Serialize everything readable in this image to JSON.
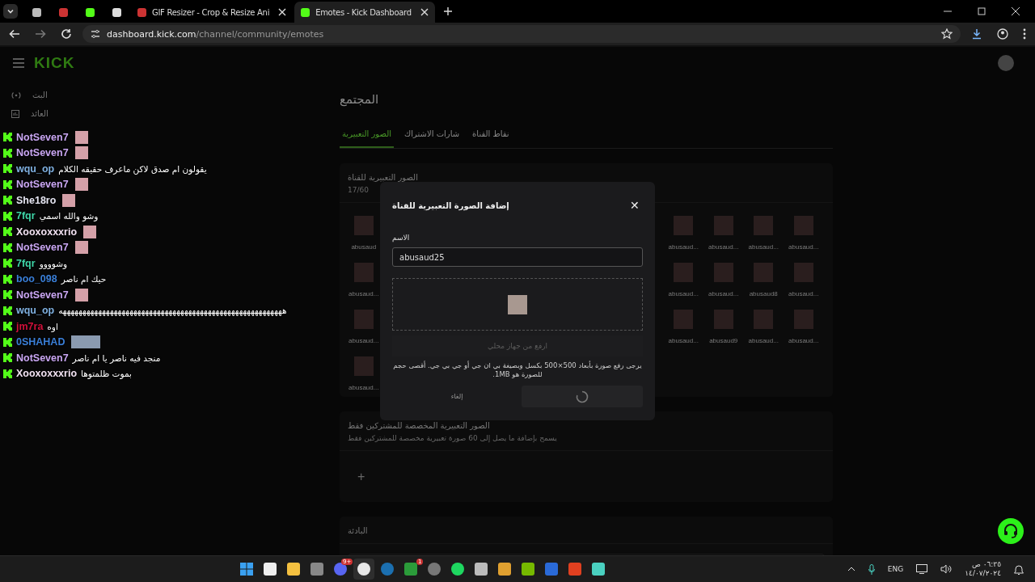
{
  "browser": {
    "tabs": [
      {
        "kind": "kick",
        "title": "Emotes - Kick Dashboard",
        "selected": true
      },
      {
        "kind": "gif",
        "title": "GIF Resizer - Crop & Resize Ani",
        "selected": false
      },
      {
        "kind": "shield",
        "selected": false
      },
      {
        "kind": "kick",
        "selected": false
      },
      {
        "kind": "gif",
        "selected": false
      },
      {
        "kind": "globe",
        "selected": false
      }
    ],
    "url_host": "dashboard.kick.com",
    "url_path": "/channel/community/emotes"
  },
  "header": {
    "logo": "KICK"
  },
  "sidebar": {
    "items": [
      {
        "kind": "live",
        "label": "البث"
      },
      {
        "kind": "revenue",
        "label": "العائد"
      }
    ]
  },
  "page": {
    "title": "المجتمع",
    "tabs": [
      {
        "label": "نقاط القناة",
        "selected": false
      },
      {
        "label": "شارات الاشتراك",
        "selected": false
      },
      {
        "label": "الصور التعبيرية",
        "selected": true
      }
    ]
  },
  "emotes_card": {
    "title": "الصور التعبيرية للقناة",
    "count": "17/60",
    "rows": [
      {
        "right": [
          "abusaud...",
          "abusaud...",
          "abusaud...",
          "abusaud..."
        ],
        "left": [
          "abusaud"
        ]
      },
      {
        "right": [
          "abusaud...",
          "abusaud8",
          "abusaud...",
          "abusaud..."
        ],
        "left": [
          "abusaud..."
        ]
      },
      {
        "right": [
          "abusaud...",
          "abusaud...",
          "abusaud9",
          "abusaud..."
        ],
        "left": [
          "abusaud..."
        ]
      },
      {
        "right": [],
        "left": [
          "abusaud..."
        ]
      }
    ]
  },
  "subscriber_card": {
    "title": "الصور التعبيرية المخصصة للمشتركين فقط",
    "subtitle": "يسمح بإضافة ما يصل إلى 60 صورة تعبيرية مخصصة للمشتركين فقط",
    "add": "+"
  },
  "banner_card": {
    "title": "البادئة"
  },
  "modal": {
    "title": "إضافة الصورة التعبيرية للقناة",
    "close": "✕",
    "name_label": "الاسم",
    "name_value": "abusaud25",
    "upload": {
      "label": "ارفع من جهاز محلي",
      "disabled": true
    },
    "hint": "يرجى رفع صورة بأبعاد 500×500 بكسل وبصيغة بي ان جي أو جي بي جي. أقصى حجم للصورة هو 1MB.",
    "cancel": "إلغاء",
    "submit_loading": true
  },
  "chat": [
    {
      "user": "NotSeven7",
      "color": "#c9a6f2",
      "kind": "emote"
    },
    {
      "user": "NotSeven7",
      "color": "#c9a6f2",
      "kind": "emote"
    },
    {
      "user": "wqu_op",
      "color": "#7fb0e0",
      "kind": "text",
      "text": "يقولون ام صدق لاكن ماعرف حقيقه الكلام"
    },
    {
      "user": "NotSeven7",
      "color": "#c9a6f2",
      "kind": "emote"
    },
    {
      "user": "She18ro",
      "color": "#e6e6f2",
      "kind": "emote"
    },
    {
      "user": "7fqr",
      "color": "#3fd6a8",
      "kind": "text",
      "text": "وشو والله اسمي"
    },
    {
      "user": "Xooxoxxxrio",
      "color": "#f2e2f2",
      "kind": "emote"
    },
    {
      "user": "NotSeven7",
      "color": "#c9a6f2",
      "kind": "emote"
    },
    {
      "user": "7fqr",
      "color": "#3fd6a8",
      "kind": "text",
      "text": "وشوووو"
    },
    {
      "user": "boo_098",
      "color": "#3a7fd8",
      "kind": "text",
      "text": "حيك ام ناصر"
    },
    {
      "user": "NotSeven7",
      "color": "#c9a6f2",
      "kind": "emote"
    },
    {
      "user": "wqu_op",
      "color": "#7fb0e0",
      "kind": "text",
      "text": "هههههههههههههههههههههههههههههههههههههههههههههههههههههههههه"
    },
    {
      "user": "jm7ra",
      "color": "#d0103a",
      "kind": "text",
      "text": "اوه"
    },
    {
      "user": "0SHAHAD",
      "color": "#3a7fd8",
      "kind": "double_emote"
    },
    {
      "user": "NotSeven7",
      "color": "#c9a6f2",
      "kind": "text",
      "text": "منجد فيه ناصر يا ام ناصر"
    },
    {
      "user": "Xooxoxxxrio",
      "color": "#f2e2f2",
      "kind": "text",
      "text": "بموت ظلمتوها"
    }
  ],
  "taskbar": {
    "apps": [
      {
        "kind": "wave"
      },
      {
        "kind": "lion"
      },
      {
        "kind": "capture"
      },
      {
        "kind": "gpu"
      },
      {
        "kind": "game"
      },
      {
        "kind": "letter"
      },
      {
        "kind": "music"
      },
      {
        "kind": "record"
      },
      {
        "kind": "xbox",
        "badge": "1"
      },
      {
        "kind": "steam"
      },
      {
        "kind": "browser",
        "active": true
      },
      {
        "kind": "chat",
        "badge": "9+"
      },
      {
        "kind": "cube"
      },
      {
        "kind": "folder"
      },
      {
        "kind": "store"
      },
      {
        "kind": "start"
      }
    ],
    "lang": "ENG",
    "time": "٠٦:٣٥ ص",
    "date": "١٤/٠٧/٢٠٢٤"
  }
}
